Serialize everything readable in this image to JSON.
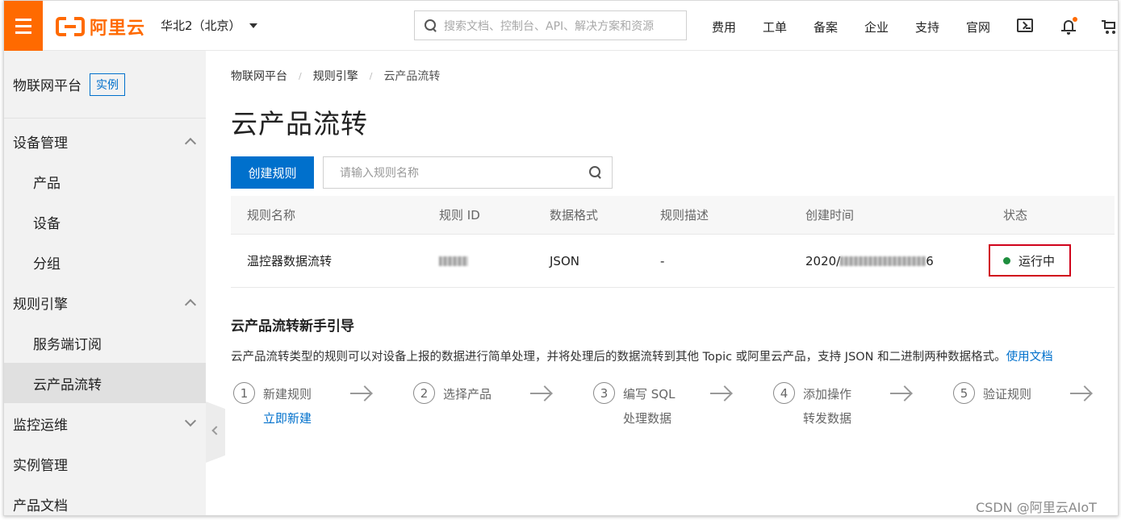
{
  "topbar": {
    "logo_text": "阿里云",
    "region": "华北2（北京）",
    "search_placeholder": "搜索文档、控制台、API、解决方案和资源",
    "nav": [
      "费用",
      "工单",
      "备案",
      "企业",
      "支持",
      "官网"
    ]
  },
  "sidebar": {
    "title": "物联网平台",
    "instance_tag": "实例",
    "groups": [
      {
        "label": "设备管理",
        "items": [
          "产品",
          "设备",
          "分组"
        ]
      },
      {
        "label": "规则引擎",
        "items": [
          "服务端订阅",
          "云产品流转"
        ]
      },
      {
        "label": "监控运维"
      },
      {
        "label": "实例管理"
      },
      {
        "label": "产品文档"
      }
    ]
  },
  "main": {
    "breadcrumb": [
      "物联网平台",
      "规则引擎",
      "云产品流转"
    ],
    "title": "云产品流转",
    "create_button": "创建规则",
    "rule_search_placeholder": "请输入规则名称",
    "table": {
      "headers": [
        "规则名称",
        "规则 ID",
        "数据格式",
        "规则描述",
        "创建时间",
        "状态"
      ],
      "rows": [
        {
          "name": "温控器数据流转",
          "format": "JSON",
          "description": "-",
          "created_prefix": "2020/",
          "created_suffix": "6",
          "status": "运行中"
        }
      ]
    },
    "guide": {
      "title": "云产品流转新手引导",
      "desc": "云产品流转类型的规则可以对设备上报的数据进行简单处理，并将处理后的数据流转到其他 Topic 或阿里云产品，支持 JSON 和二进制两种数据格式。",
      "doc_link": "使用文档",
      "steps": [
        {
          "num": "1",
          "label": "新建规则",
          "link": "立即新建"
        },
        {
          "num": "2",
          "label": "选择产品"
        },
        {
          "num": "3",
          "label": "编写 SQL",
          "label2": "处理数据"
        },
        {
          "num": "4",
          "label": "添加操作",
          "label2": "转发数据"
        },
        {
          "num": "5",
          "label": "验证规则"
        }
      ]
    }
  },
  "watermark": "CSDN @阿里云AIoT",
  "colors": {
    "brand_orange": "#ff6a00",
    "primary_blue": "#0070cc",
    "status_green": "#1e8e3e",
    "highlight_red": "#d0021b"
  }
}
